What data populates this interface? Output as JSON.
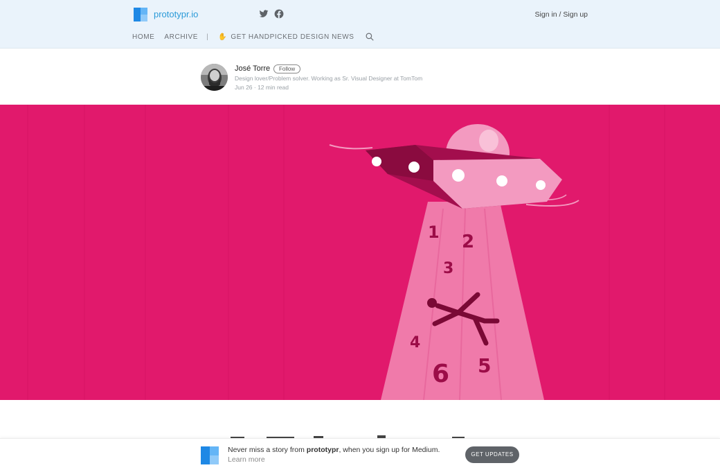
{
  "header": {
    "logo_text": "prototypr.io",
    "sign_in": "Sign in / Sign up",
    "nav": {
      "home": "HOME",
      "archive": "ARCHIVE",
      "divider": "|",
      "wave": "✋",
      "news": "GET HANDPICKED DESIGN NEWS"
    }
  },
  "author": {
    "name": "José Torre",
    "follow": "Follow",
    "bio": "Design lover/Problem solver. Working as Sr. Visual Designer at TomTom",
    "meta": "Jun 26 · 12 min read"
  },
  "hero": {
    "numbers": [
      "1",
      "2",
      "3",
      "4",
      "5",
      "6"
    ],
    "colors": {
      "background": "#e1196c",
      "beam": "#f07aaa",
      "ufo_dark": "#8a0b3f",
      "ufo_light": "#f39ac0"
    }
  },
  "banner": {
    "text_prefix": "Never miss a story from ",
    "publication": "prototypr",
    "text_suffix": ", when you sign up for Medium.",
    "learn_more": "Learn more",
    "button": "GET UPDATES"
  },
  "colors": {
    "accent": "#2a9ad8",
    "topbar_bg": "#eaf3fb",
    "button_bg": "#5f6368"
  }
}
